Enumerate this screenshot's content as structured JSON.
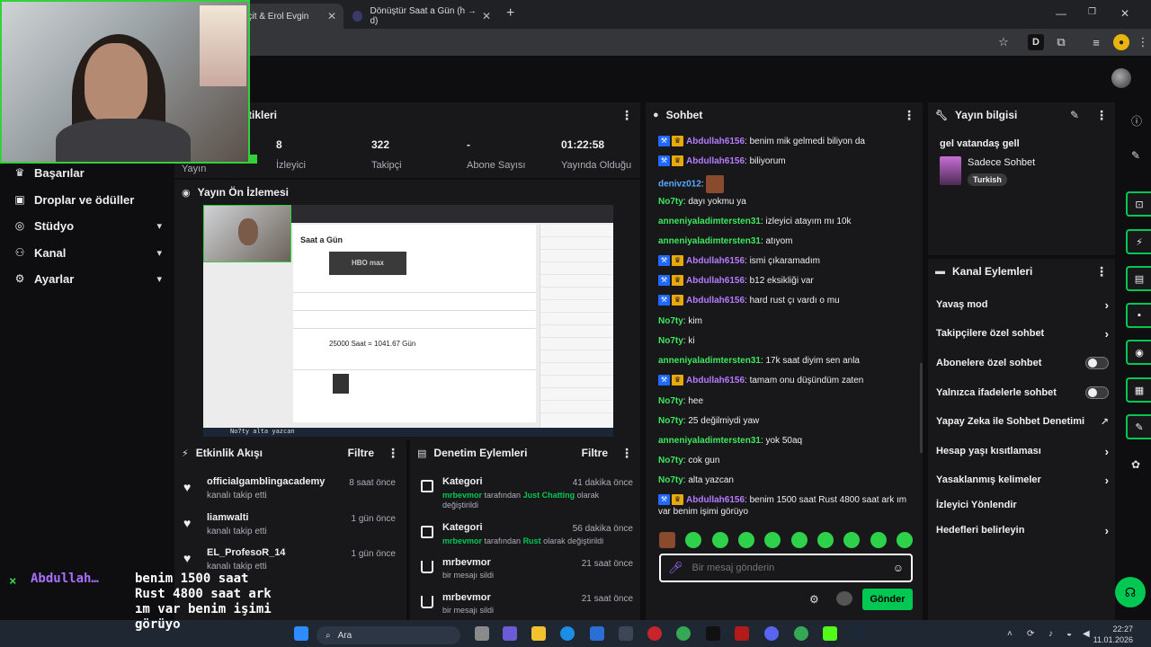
{
  "browser": {
    "tabs": [
      {
        "title": "eçit & Erol Evgin"
      },
      {
        "title": "Dönüştür Saat a Gün (h → d)"
      }
    ],
    "new_tab": "+"
  },
  "sidebar": {
    "items": [
      {
        "label": "Başarılar",
        "icon": "trophy-icon",
        "has_chevron": false
      },
      {
        "label": "Droplar ve ödüller",
        "icon": "gift-icon",
        "has_chevron": false
      },
      {
        "label": "Stüdyo",
        "icon": "studio-icon",
        "has_chevron": true
      },
      {
        "label": "Kanal",
        "icon": "users-icon",
        "has_chevron": true
      },
      {
        "label": "Ayarlar",
        "icon": "gear-icon",
        "has_chevron": true
      }
    ]
  },
  "stats": {
    "title": "tikleri",
    "left_label": "Yayın",
    "items": [
      {
        "value": "8",
        "label": "İzleyici"
      },
      {
        "value": "322",
        "label": "Takipçi"
      },
      {
        "value": "-",
        "label": "Abone Sayısı"
      },
      {
        "value": "01:22:58",
        "label": "Yayında Olduğu"
      }
    ]
  },
  "preview": {
    "title": "Yayın Ön İzlemesi",
    "inner_heading": "Saat a Gün",
    "logo_text": "HBO max",
    "result_text": "25000 Saat = 1041.67 Gün",
    "ticker": "No7ty alta yazcan"
  },
  "activity": {
    "title": "Etkinlik Akışı",
    "filter": "Filtre",
    "items": [
      {
        "name": "officialgamblingacademy",
        "action": "kanalı takip etti",
        "time": "8 saat önce"
      },
      {
        "name": "liamwalti",
        "action": "kanalı takip etti",
        "time": "1 gün önce"
      },
      {
        "name": "EL_ProfesoR_14",
        "action": "kanalı takip etti",
        "time": "1 gün önce"
      }
    ]
  },
  "mod_actions": {
    "title": "Denetim Eylemleri",
    "filter": "Filtre",
    "items": [
      {
        "title": "Kategori",
        "time": "41 dakika önce",
        "user": "mrbevmor",
        "mid": " tarafından ",
        "target": "Just Chatting",
        "tail": " olarak değiştirildi"
      },
      {
        "title": "Kategori",
        "time": "56 dakika önce",
        "user": "mrbevmor",
        "mid": " tarafından ",
        "target": "Rust",
        "tail": " olarak değiştirildi"
      },
      {
        "title": "mrbevmor",
        "time": "21 saat önce",
        "desc": "bir mesajı sildi"
      },
      {
        "title": "mrbevmor",
        "time": "21 saat önce",
        "desc": "bir mesajı sildi"
      }
    ]
  },
  "chat": {
    "title": "Sohbet",
    "messages": [
      {
        "user": "Abdullah6156",
        "color": "purple",
        "badges": true,
        "text": ": benim mik gelmedi biliyon da"
      },
      {
        "user": "Abdullah6156",
        "color": "purple",
        "badges": true,
        "text": ": biliyorum"
      },
      {
        "user": "denivz012",
        "color": "blue",
        "badges": false,
        "text": ": ",
        "emote": true
      },
      {
        "user": "No7ty",
        "color": "green",
        "badges": false,
        "text": ": dayı yokmu ya"
      },
      {
        "user": "anneniyaladimtersten31",
        "color": "green",
        "badges": false,
        "text": ": izleyici atayım mı 10k"
      },
      {
        "user": "anneniyaladimtersten31",
        "color": "green",
        "badges": false,
        "text": ": atıyom"
      },
      {
        "user": "Abdullah6156",
        "color": "purple",
        "badges": true,
        "text": ": ismi çıkaramadım"
      },
      {
        "user": "Abdullah6156",
        "color": "purple",
        "badges": true,
        "text": ": b12 eksikliği var"
      },
      {
        "user": "Abdullah6156",
        "color": "purple",
        "badges": true,
        "text": ": hard rust çı vardı o mu"
      },
      {
        "user": "No7ty",
        "color": "green",
        "badges": false,
        "text": ": kim"
      },
      {
        "user": "No7ty",
        "color": "green",
        "badges": false,
        "text": ": ki"
      },
      {
        "user": "anneniyaladimtersten31",
        "color": "green",
        "badges": false,
        "text": ": 17k saat diyim sen anla"
      },
      {
        "user": "Abdullah6156",
        "color": "purple",
        "badges": true,
        "text": ": tamam onu düşündüm zaten"
      },
      {
        "user": "No7ty",
        "color": "green",
        "badges": false,
        "text": ": hee"
      },
      {
        "user": "No7ty",
        "color": "green",
        "badges": false,
        "text": ": 25 değilmiydi yaw"
      },
      {
        "user": "anneniyaladimtersten31",
        "color": "green",
        "badges": false,
        "text": ": yok 50aq"
      },
      {
        "user": "No7ty",
        "color": "green",
        "badges": false,
        "text": ": cok gun"
      },
      {
        "user": "No7ty",
        "color": "green",
        "badges": false,
        "text": ": alta yazcan"
      },
      {
        "user": "Abdullah6156",
        "color": "purple",
        "badges": true,
        "text": ": benim 1500 saat Rust 4800 saat ark ım var benim işimi görüyo"
      }
    ],
    "input_placeholder": "Bir mesaj gönderin",
    "send_label": "Gönder"
  },
  "stream_info": {
    "title": "Yayın bilgisi",
    "stream_title": "gel vatandaş gell",
    "category": "Sadece Sohbet",
    "tag": "Turkish"
  },
  "channel_actions": {
    "title": "Kanal Eylemleri",
    "items": [
      {
        "label": "Yavaş mod",
        "kind": "arrow"
      },
      {
        "label": "Takipçilere özel sohbet",
        "kind": "arrow"
      },
      {
        "label": "Abonelere özel sohbet",
        "kind": "toggle"
      },
      {
        "label": "Yalnızca ifadelerle sohbet",
        "kind": "toggle"
      },
      {
        "label": "Yapay Zeka ile Sohbet Denetimi",
        "kind": "external"
      },
      {
        "label": "Hesap yaşı kısıtlaması",
        "kind": "arrow"
      },
      {
        "label": "Yasaklanmış kelimeler",
        "kind": "arrow"
      },
      {
        "label": "İzleyici Yönlendir",
        "kind": "none"
      },
      {
        "label": "Hedefleri belirleyin",
        "kind": "arrow"
      }
    ]
  },
  "overlay": {
    "x": "×",
    "name": "Abdullah…",
    "message": "benim 1500 saat\nRust 4800 saat ark\nım var benim işimi\ngörüyo"
  },
  "taskbar": {
    "search": "Ara",
    "time": "22:27",
    "date": "11.01.2026"
  },
  "colors": {
    "accent": "#00c853",
    "panel": "#18181b",
    "background": "#0e0e10"
  }
}
